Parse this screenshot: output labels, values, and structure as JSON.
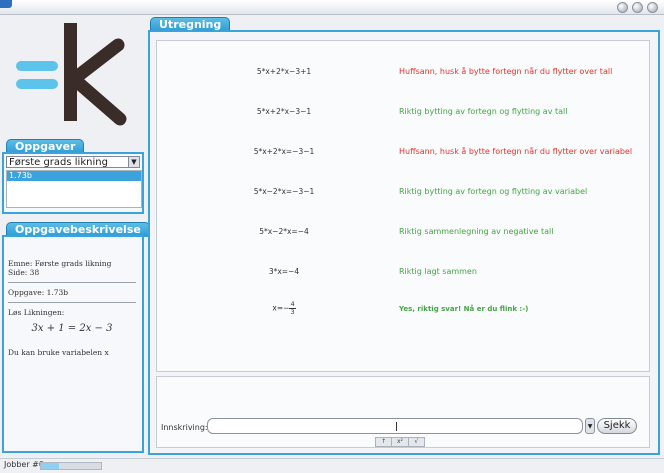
{
  "tasks_panel": {
    "tab_label": "Oppgaver",
    "category_selected": "Første grads likning",
    "selected_task": "1.73b"
  },
  "description_panel": {
    "tab_label": "Oppgavebeskrivelse",
    "topic_line": "Emne: Første grads likning",
    "page_line": "Side: 38",
    "task_line": "Oppgave: 1.73b",
    "instruction": "Løs Likningen:",
    "equation": "3x + 1 = 2x − 3",
    "variable_hint": "Du kan bruke variabelen x"
  },
  "work_panel": {
    "tab_label": "Utregning",
    "steps": [
      {
        "expr": "5*x+2*x−3+1",
        "message": "Huffsann, husk å bytte fortegn når du flytter over tall",
        "status": "error"
      },
      {
        "expr": "5*x+2*x−3−1",
        "message": "Riktig bytting av fortegn og flytting av tall",
        "status": "ok"
      },
      {
        "expr": "5*x+2*x=−3−1",
        "message": "Huffsann, husk å bytte fortegn når du flytter over variabel",
        "status": "error"
      },
      {
        "expr": "5*x−2*x=−3−1",
        "message": "Riktig bytting av fortegn og flytting av variabel",
        "status": "ok"
      },
      {
        "expr": "5*x−2*x=−4",
        "message": "Riktig sammenlegning av negative tall",
        "status": "ok"
      },
      {
        "expr": "3*x=−4",
        "message": "Riktig lagt sammen",
        "status": "ok"
      },
      {
        "expr_prefix": "x=−",
        "expr_num": "4",
        "expr_den": "3",
        "message": "Yes, riktig svar! Nå er du flink :-)",
        "status": "success"
      }
    ]
  },
  "input": {
    "label": "Innskriving:",
    "value": "",
    "check_button": "Sjekk",
    "symbols": [
      "↑",
      "x²",
      "√"
    ]
  },
  "status": {
    "label": "Jobber #0",
    "progress": 0.3
  },
  "colors": {
    "accent": "#3aa3dc",
    "error": "#e8322a",
    "ok": "#45a545",
    "logo_bar": "#5cc3ea",
    "logo_k": "#3a2c28"
  }
}
